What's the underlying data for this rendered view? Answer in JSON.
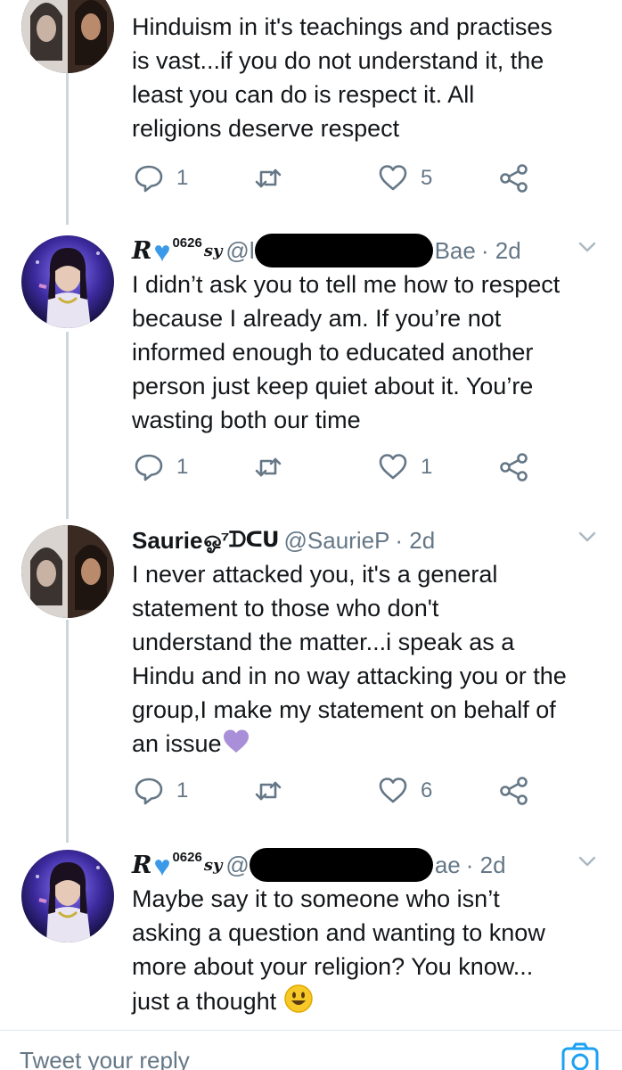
{
  "tweets": [
    {
      "name": "",
      "handle": "",
      "time": "",
      "text": "Hinduism in it's teachings and practises\nis vast...if you do not understand it, the\nleast you can do is respect it. All\nreligions deserve respect",
      "reply_count": "1",
      "like_count": "5"
    },
    {
      "name_prefix": "R",
      "name_num": "0626",
      "name_suffix": "sy",
      "handle_start": "@l",
      "handle_end": "Bae",
      "time": "· 2d",
      "text": "I didn’t ask you to tell me how to respect\nbecause I already am. If you’re not\ninformed enough to educated another\nperson just keep quiet about it. You’re\nwasting both our time",
      "reply_count": "1",
      "like_count": "1"
    },
    {
      "name": "Saurie",
      "name_deco": "ஓ⁷ᗪᑕᑌ",
      "handle": "@SaurieP",
      "time": "· 2d",
      "text": "I never attacked you, it's a general\nstatement to those who don't\nunderstand the matter...i speak as a\nHindu and in no way attacking you or the\ngroup,I make my statement on behalf of\nan issue",
      "reply_count": "1",
      "like_count": "6"
    },
    {
      "name_prefix": "R",
      "name_num": "0626",
      "name_suffix": "sy",
      "handle_start": "@",
      "handle_end": "ae",
      "time": "· 2d",
      "text": "Maybe say it to someone who isn’t\nasking a question and wanting to know\nmore about your religion? You know...\njust a thought",
      "reply_count": "",
      "like_count": ""
    }
  ],
  "reply_bar": {
    "placeholder": "Tweet your reply"
  },
  "icons": {
    "reply": "reply-icon",
    "retweet": "retweet-icon",
    "like": "heart-icon",
    "share": "share-icon",
    "caret": "chevron-down-icon",
    "camera": "camera-icon"
  },
  "colors": {
    "text": "#14171a",
    "secondary": "#657786",
    "thread_line": "#ccd6dd",
    "blue_heart": "#3b9ae8",
    "purple_heart": "#a88fd8"
  }
}
